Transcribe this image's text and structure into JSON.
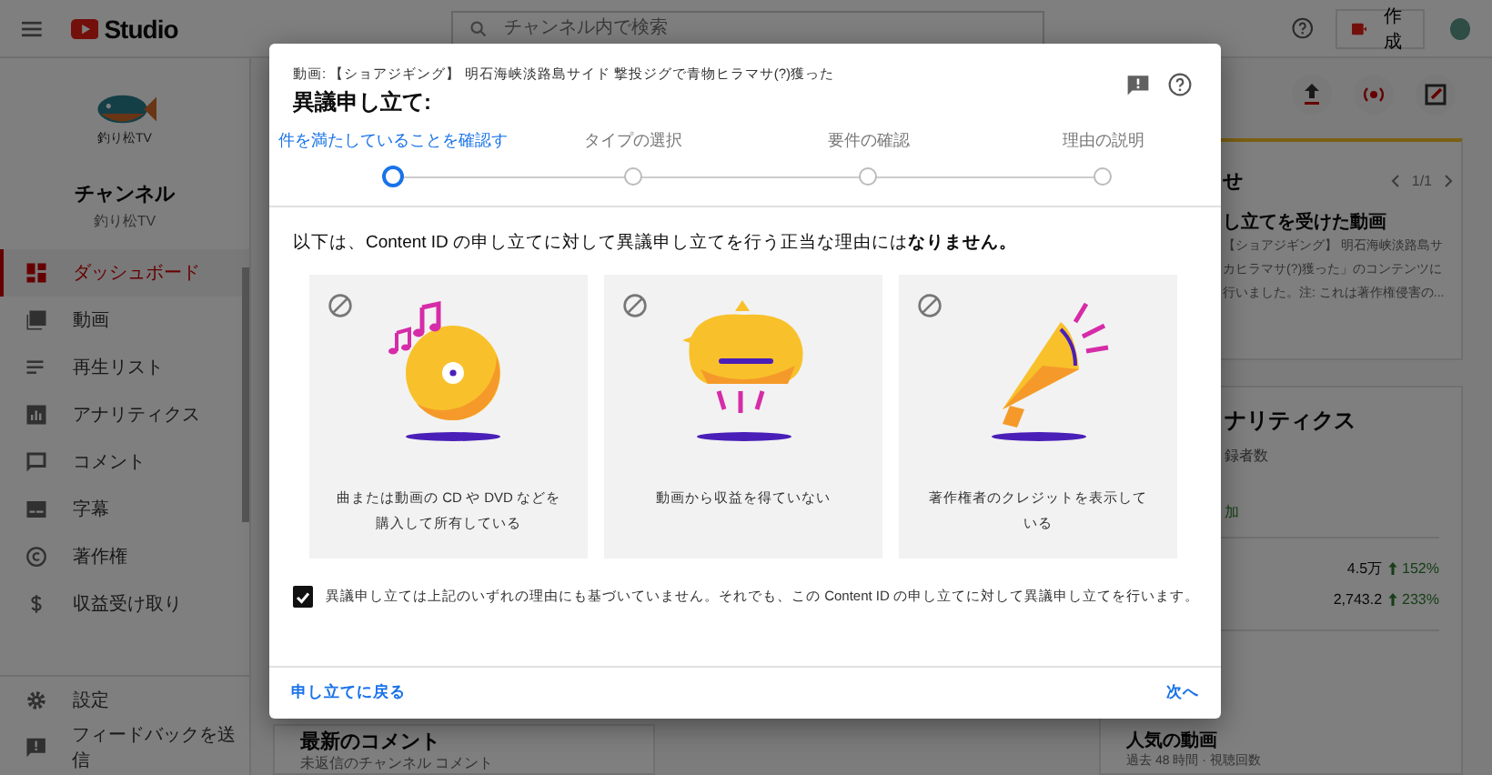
{
  "topbar": {
    "logo_text": "Studio",
    "search": {
      "placeholder": "チャンネル内で検索"
    },
    "create_button": "作成"
  },
  "sidebar": {
    "logo_text": "釣り松TV",
    "channel_title": "チャンネル",
    "channel_name": "釣り松TV",
    "items": [
      {
        "label": "ダッシュボード",
        "kind": "dashboard",
        "selected": true
      },
      {
        "label": "動画",
        "kind": "video",
        "selected": false
      },
      {
        "label": "再生リスト",
        "kind": "playlist",
        "selected": false
      },
      {
        "label": "アナリティクス",
        "kind": "analytics",
        "selected": false
      },
      {
        "label": "コメント",
        "kind": "comment",
        "selected": false
      },
      {
        "label": "字幕",
        "kind": "subtitles",
        "selected": false
      },
      {
        "label": "著作権",
        "kind": "copyright",
        "selected": false
      },
      {
        "label": "収益受け取り",
        "kind": "dollar",
        "selected": false
      }
    ],
    "footer_items": [
      {
        "label": "設定",
        "kind": "settings"
      },
      {
        "label": "フィードバックを送信",
        "kind": "feedback"
      }
    ]
  },
  "dashboard": {
    "notice": {
      "title": "せ",
      "pager": "1/1",
      "heading": "し立てを受けた動画",
      "lines": [
        "【ショアジギング】 明石海峡淡路島サ",
        "カヒラマサ(?)獲った」のコンテンツに",
        "行いました。注: これは著作権侵害の..."
      ]
    },
    "analytics": {
      "title": "ナリティクス",
      "subtitle": "録者数",
      "change": "加",
      "metrics": [
        {
          "value": "4.5万",
          "delta": "152%"
        },
        {
          "value": "2,743.2",
          "delta": "233%"
        }
      ]
    },
    "popular": {
      "title": "人気の動画",
      "subtitle": "過去 48 時間 · 視聴回数"
    },
    "comments": {
      "title": "最新のコメント",
      "subtitle": "未返信のチャンネル コメント"
    }
  },
  "dialog": {
    "video_title": "動画: 【ショアジギング】 明石海峡淡路島サイド 撃投ジグで青物ヒラマサ(?)獲った",
    "title": "異議申し立て:",
    "steps": [
      {
        "label": "件を満たしていることを確認す",
        "selected": true
      },
      {
        "label": "タイプの選択",
        "selected": false
      },
      {
        "label": "要件の確認",
        "selected": false
      },
      {
        "label": "理由の説明",
        "selected": false
      }
    ],
    "intro": "以下は、Content ID の申し立てに対して異議申し立てを行う正当な理由には**なりません。**",
    "cards": [
      {
        "kind": "disc",
        "caption": "曲または動画の CD や DVD などを購入して所有している"
      },
      {
        "kind": "piggy",
        "caption": "動画から収益を得ていない"
      },
      {
        "kind": "megaphone",
        "caption": "著作権者のクレジットを表示している"
      }
    ],
    "confirm": {
      "checked": true,
      "label": "異議申し立ては上記のいずれの理由にも基づいていません。それでも、この Content ID の申し立てに対して異議申し立てを行います。"
    },
    "back_button": "申し立てに戻る",
    "next_button": "次へ"
  }
}
